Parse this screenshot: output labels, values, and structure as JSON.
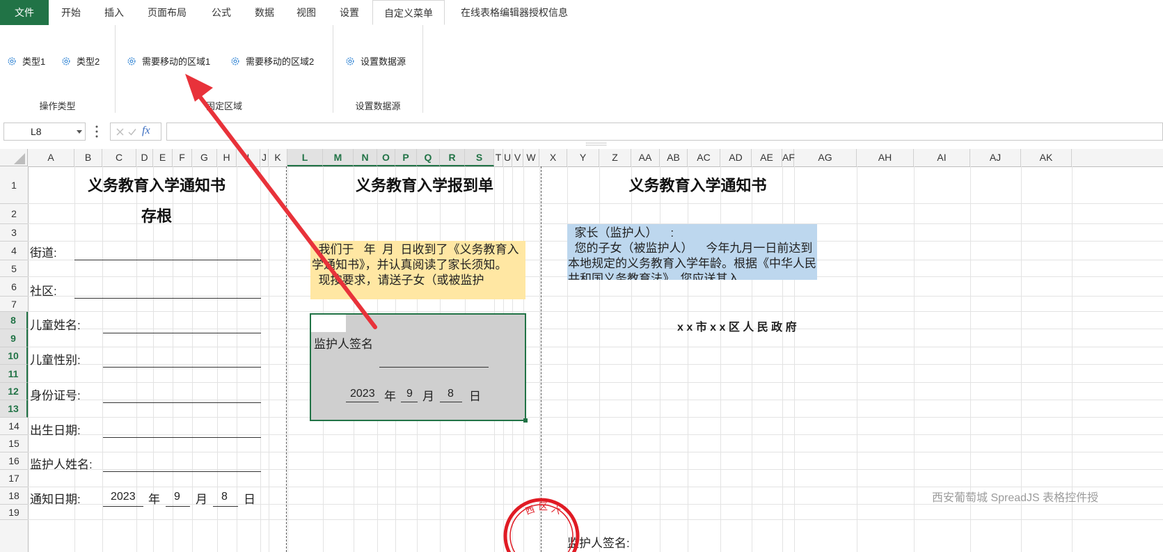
{
  "tabs": {
    "file": "文件",
    "home": "开始",
    "insert": "插入",
    "layout": "页面布局",
    "formula": "公式",
    "data": "数据",
    "view": "视图",
    "settings": "设置",
    "custom": "自定义菜单",
    "license": "在线表格编辑器授权信息"
  },
  "ribbon": {
    "type1": "类型1",
    "type2": "类型2",
    "move_area1": "需要移动的区域1",
    "move_area2": "需要移动的区域2",
    "set_datasource": "设置数据源",
    "group_op_type": "操作类型",
    "group_fixed_area": "固定区域",
    "group_datasource": "设置数据源"
  },
  "formula_bar": {
    "cell_ref": "L8",
    "fx": "fx",
    "content": ""
  },
  "columns": [
    "A",
    "B",
    "C",
    "D",
    "E",
    "F",
    "G",
    "H",
    "I",
    "J",
    "K",
    "L",
    "M",
    "N",
    "O",
    "P",
    "Q",
    "R",
    "S",
    "T",
    "U",
    "V",
    "W",
    "X",
    "Y",
    "Z",
    "AA",
    "AB",
    "AC",
    "AD",
    "AE",
    "AF",
    "AG",
    "AH",
    "AI",
    "AJ",
    "AK"
  ],
  "rows": [
    "1",
    "2",
    "3",
    "4",
    "5",
    "6",
    "7",
    "8",
    "9",
    "10",
    "11",
    "12",
    "13",
    "14",
    "15",
    "16",
    "17",
    "18",
    "19"
  ],
  "sheet": {
    "stub_title": "义务教育入学通知书",
    "stub_subtitle": "存根",
    "street_label": "街道:",
    "community_label": "社区:",
    "child_name_label": "儿童姓名:",
    "child_gender_label": "儿童性别:",
    "id_label": "身份证号:",
    "birth_label": "出生日期:",
    "guardian_name_label": "监护人姓名:",
    "notice_date_label": "通知日期:",
    "year_val": "2023",
    "year": "年",
    "month_val": "9",
    "month": "月",
    "day_val": "8",
    "day": "日",
    "report_title": "义务教育入学报到单",
    "report_para": "  我们于   年  月  日收到了《义务教育入学通知书》，并认真阅读了家长须知。\n  现按要求，请送子女（或被监护",
    "guardian_sign": "监护人签名",
    "sel_year_val": "2023",
    "sel_month_val": "9",
    "sel_day_val": "8",
    "notice_title": "义务教育入学通知书",
    "notice_para": "  家长（监护人）    :\n  您的子女（被监护人）    今年九月一日前达到本地规定的义务教育入学年龄。根据《中华人民共和国义务教育法》，您应送其入",
    "gov_name": "x x 市 x x 区 人 民 政 府",
    "guardian_sign2": "监护人签名:",
    "watermark": "西安葡萄城 SpreadJS 表格控件授"
  },
  "colors": {
    "accent": "#217346",
    "yellow": "#ffe7a3",
    "blue": "#bdd7ee",
    "selection": "#cfcfcf",
    "arrow": "#e8323a",
    "seal": "#e01b24"
  }
}
